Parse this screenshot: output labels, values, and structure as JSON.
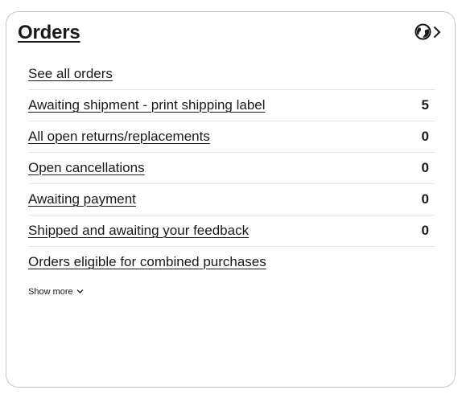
{
  "card": {
    "title": "Orders",
    "header_icons": [
      "globe-icon",
      "chevron-right-icon"
    ]
  },
  "orders": {
    "items": [
      {
        "label": "See all orders",
        "count": ""
      },
      {
        "label": "Awaiting shipment - print shipping label",
        "count": "5"
      },
      {
        "label": "All open returns/replacements",
        "count": "0"
      },
      {
        "label": "Open cancellations",
        "count": "0"
      },
      {
        "label": "Awaiting payment",
        "count": "0"
      },
      {
        "label": "Shipped and awaiting your feedback",
        "count": "0"
      },
      {
        "label": "Orders eligible for combined purchases",
        "count": ""
      }
    ]
  },
  "show_more": {
    "label": "Show more",
    "icon": "chevron-down-icon"
  }
}
